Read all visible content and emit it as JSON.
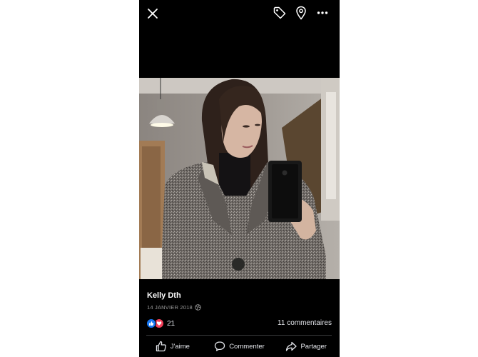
{
  "post": {
    "author": "Kelly Dth",
    "date": "14 JANVIER 2018"
  },
  "reactions": {
    "count": "21",
    "types": [
      "like-icon",
      "love-icon"
    ],
    "colors": {
      "like": "#1877f2",
      "love": "#f33e58"
    }
  },
  "comments": {
    "label": "11 commentaires"
  },
  "actions": {
    "like_label": "J'aime",
    "comment_label": "Commenter",
    "share_label": "Partager"
  },
  "toolbar": {
    "icons": [
      "close-icon",
      "tag-icon",
      "location-pin-icon",
      "more-icon"
    ]
  }
}
